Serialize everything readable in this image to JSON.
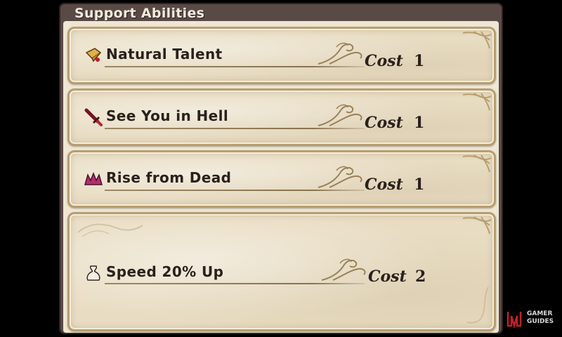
{
  "header": {
    "title": "Support Abilities"
  },
  "abilities": [
    {
      "name": "Natural Talent",
      "cost_label": "Cost",
      "cost": "1",
      "icon": "scroll-icon"
    },
    {
      "name": "See You in Hell",
      "cost_label": "Cost",
      "cost": "1",
      "icon": "sword-icon"
    },
    {
      "name": "Rise from Dead",
      "cost_label": "Cost",
      "cost": "1",
      "icon": "wings-icon"
    },
    {
      "name": "Speed 20% Up",
      "cost_label": "Cost",
      "cost": "2",
      "icon": "pouch-icon"
    }
  ],
  "watermark": {
    "line1": "GAMER",
    "line2": "GUIDES"
  },
  "colors": {
    "frame": "#5a4a46",
    "parchment": "#e8dcc2",
    "border": "#b79e70",
    "text": "#2a211c"
  }
}
